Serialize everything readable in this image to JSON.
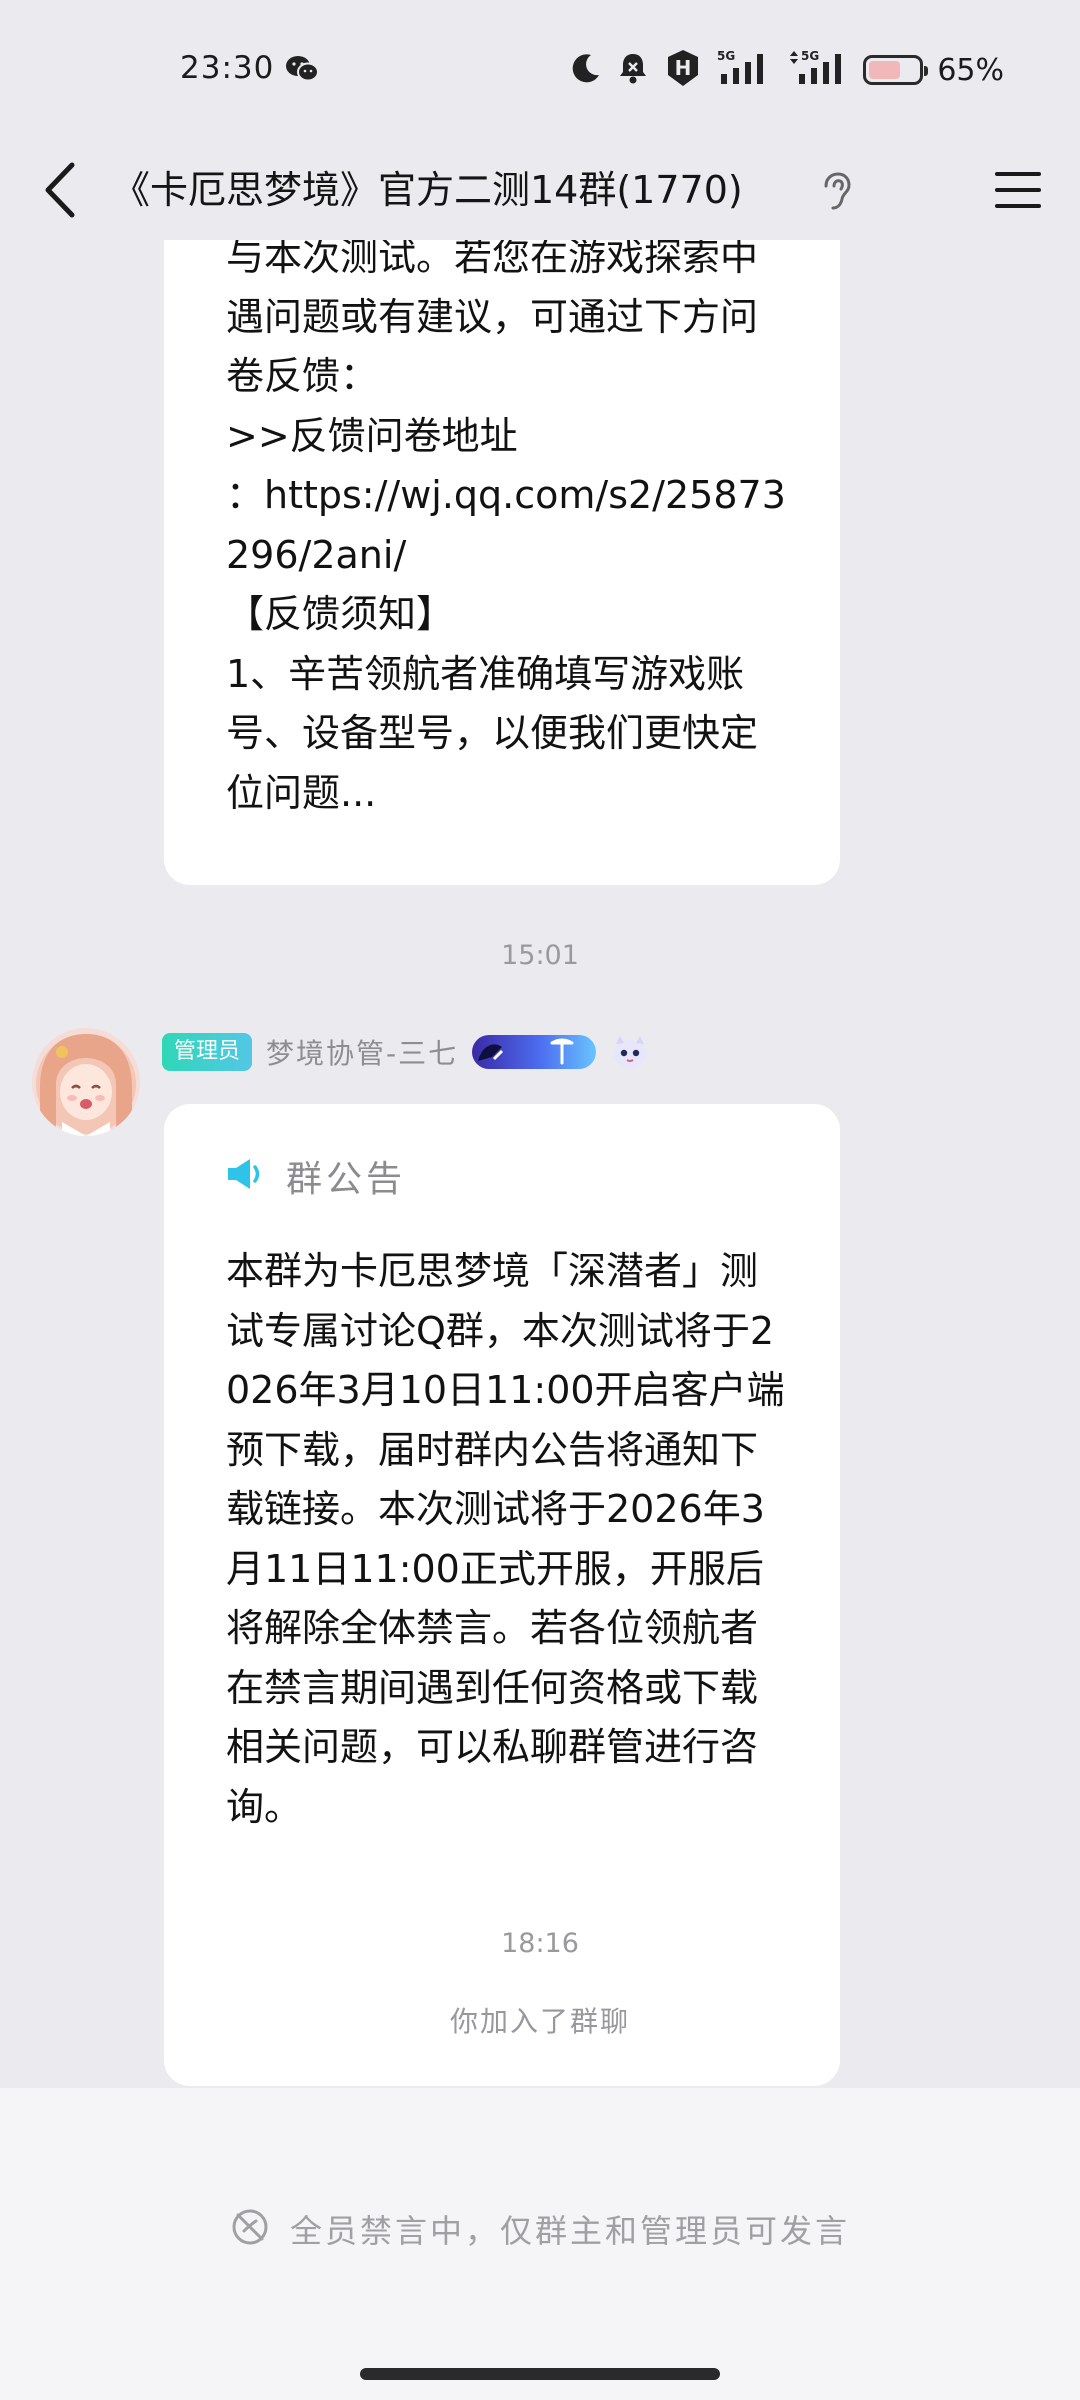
{
  "status_bar": {
    "time": "23:30",
    "network_1": "5G",
    "network_2": "5G",
    "battery_percent": 65,
    "battery_text": "65%"
  },
  "header": {
    "title": "《卡厄思梦境》官方二测14群(1770)",
    "icons": [
      "back-arrow-icon",
      "ear-icon",
      "menu-icon"
    ]
  },
  "messages": [
    {
      "type": "text",
      "text": "与本次测试。若您在游戏探索中遇问题或有建议，可通过下方问卷反馈：\n>>反馈问卷地址\n：https://wj.qq.com/s2/25873296/2ani/\n【反馈须知】\n1、辛苦领航者准确填写游戏账号、设备型号，以便我们更快定位问题..."
    }
  ],
  "timestamps": {
    "first": "15:01",
    "second": "18:16"
  },
  "announcement": {
    "sender_badge": "管理员",
    "sender_name": "梦境协管-三七",
    "title": "群公告",
    "body": "本群为卡厄思梦境「深潜者」测试专属讨论Q群，本次测试将于2026年3月10日11:00开启客户端预下载，届时群内公告将通知下载链接。本次测试将于2026年3月11日11:00正式开服，开服后将解除全体禁言。若各位领航者在禁言期间遇到任何资格或下载相关问题，可以私聊群管进行咨询。"
  },
  "system_notice": "你加入了群聊",
  "bottom_bar": {
    "mute_text": "全员禁言中，仅群主和管理员可发言"
  },
  "colors": {
    "background": "#ebebef",
    "bubble": "#ffffff",
    "admin_badge": "#2fd7b7",
    "announcement_icon": "#2ec3e8",
    "muted_text": "#9a9a9e"
  }
}
